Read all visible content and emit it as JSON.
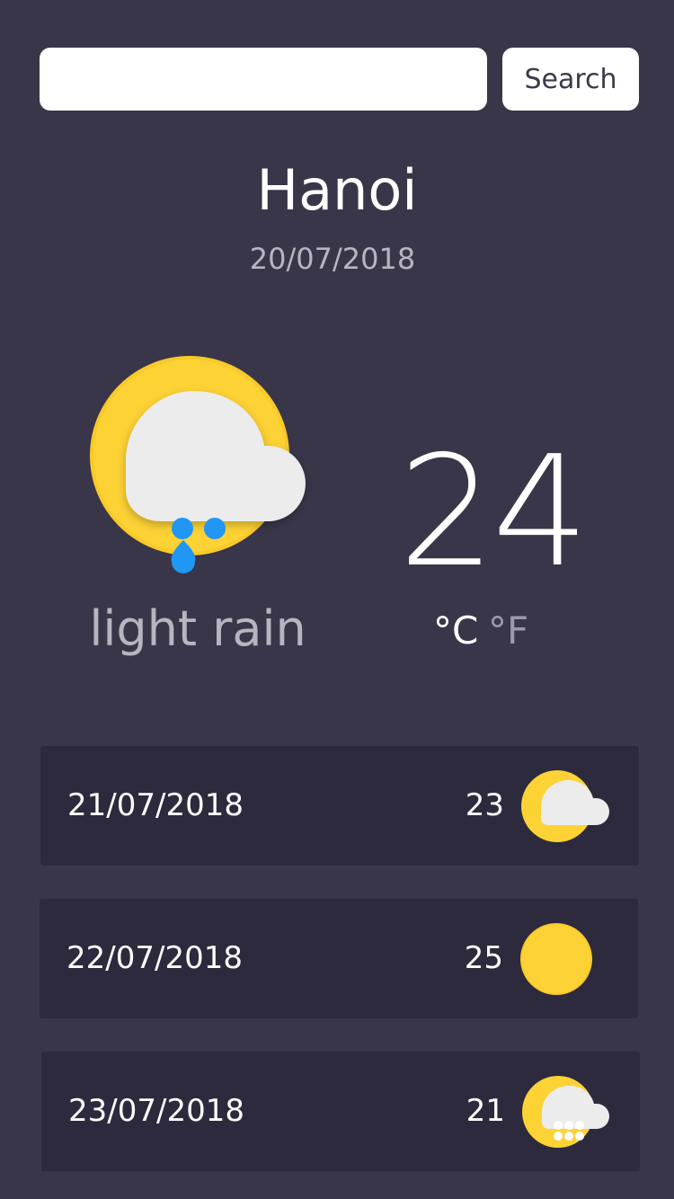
{
  "search": {
    "value": "",
    "placeholder": "",
    "button_label": "Search"
  },
  "current": {
    "city": "Hanoi",
    "date": "20/07/2018",
    "icon": "light-rain-icon",
    "condition": "light rain",
    "temperature": "24",
    "unit_celsius": "°C",
    "unit_fahrenheit": "°F",
    "active_unit": "C"
  },
  "forecast": [
    {
      "date": "21/07/2018",
      "temp": "23",
      "icon": "cloudy-icon"
    },
    {
      "date": "22/07/2018",
      "temp": "25",
      "icon": "sun-icon"
    },
    {
      "date": "23/07/2018",
      "temp": "21",
      "icon": "snow-icon"
    }
  ],
  "colors": {
    "background": "#393649",
    "card": "#2d2a3d",
    "sun": "#fdd234",
    "cloud": "#ececec",
    "rain": "#2196f3",
    "muted_text": "#b6b5c0"
  }
}
